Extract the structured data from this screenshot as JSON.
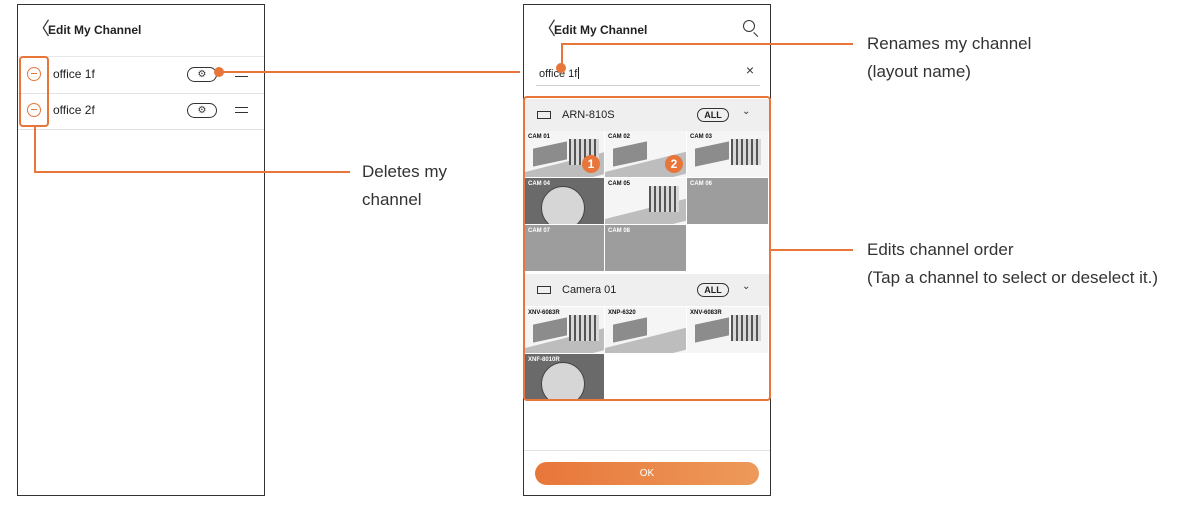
{
  "left_screen": {
    "header": {
      "back_icon": "chevron-left-icon",
      "back_glyph": "〈",
      "title": "Edit My Channel"
    },
    "channels": [
      {
        "label": "office 1f",
        "settings_glyph": "⚙"
      },
      {
        "label": "office 2f",
        "settings_glyph": "⚙"
      }
    ]
  },
  "right_screen": {
    "header": {
      "back_glyph": "〈",
      "title": "Edit My Channel",
      "search_icon": "search-icon"
    },
    "name_input": {
      "value": "office 1f",
      "clear_glyph": "×"
    },
    "groups": [
      {
        "name": "ARN-810S",
        "all_label": "ALL",
        "chevron": "⌄",
        "cells": [
          "CAM 01",
          "CAM 02",
          "CAM 03",
          "CAM 04",
          "CAM 05",
          "CAM 06",
          "CAM 07",
          "CAM 08"
        ]
      },
      {
        "name": "Camera 01",
        "all_label": "ALL",
        "chevron": "⌄",
        "cells": [
          "XNV-6083R",
          "XNP-6320",
          "XNV-6083R",
          "XNF-8010R"
        ]
      }
    ],
    "selection_badges": [
      "1",
      "2"
    ],
    "ok_label": "OK"
  },
  "annotations": {
    "rename": {
      "line1": "Renames my channel",
      "line2": "(layout name)"
    },
    "delete": {
      "line1": "Deletes my",
      "line2": "channel"
    },
    "order": {
      "line1": "Edits channel order",
      "line2": "(Tap a channel to select or deselect it.)"
    }
  },
  "colors": {
    "accent": "#e8763a"
  }
}
